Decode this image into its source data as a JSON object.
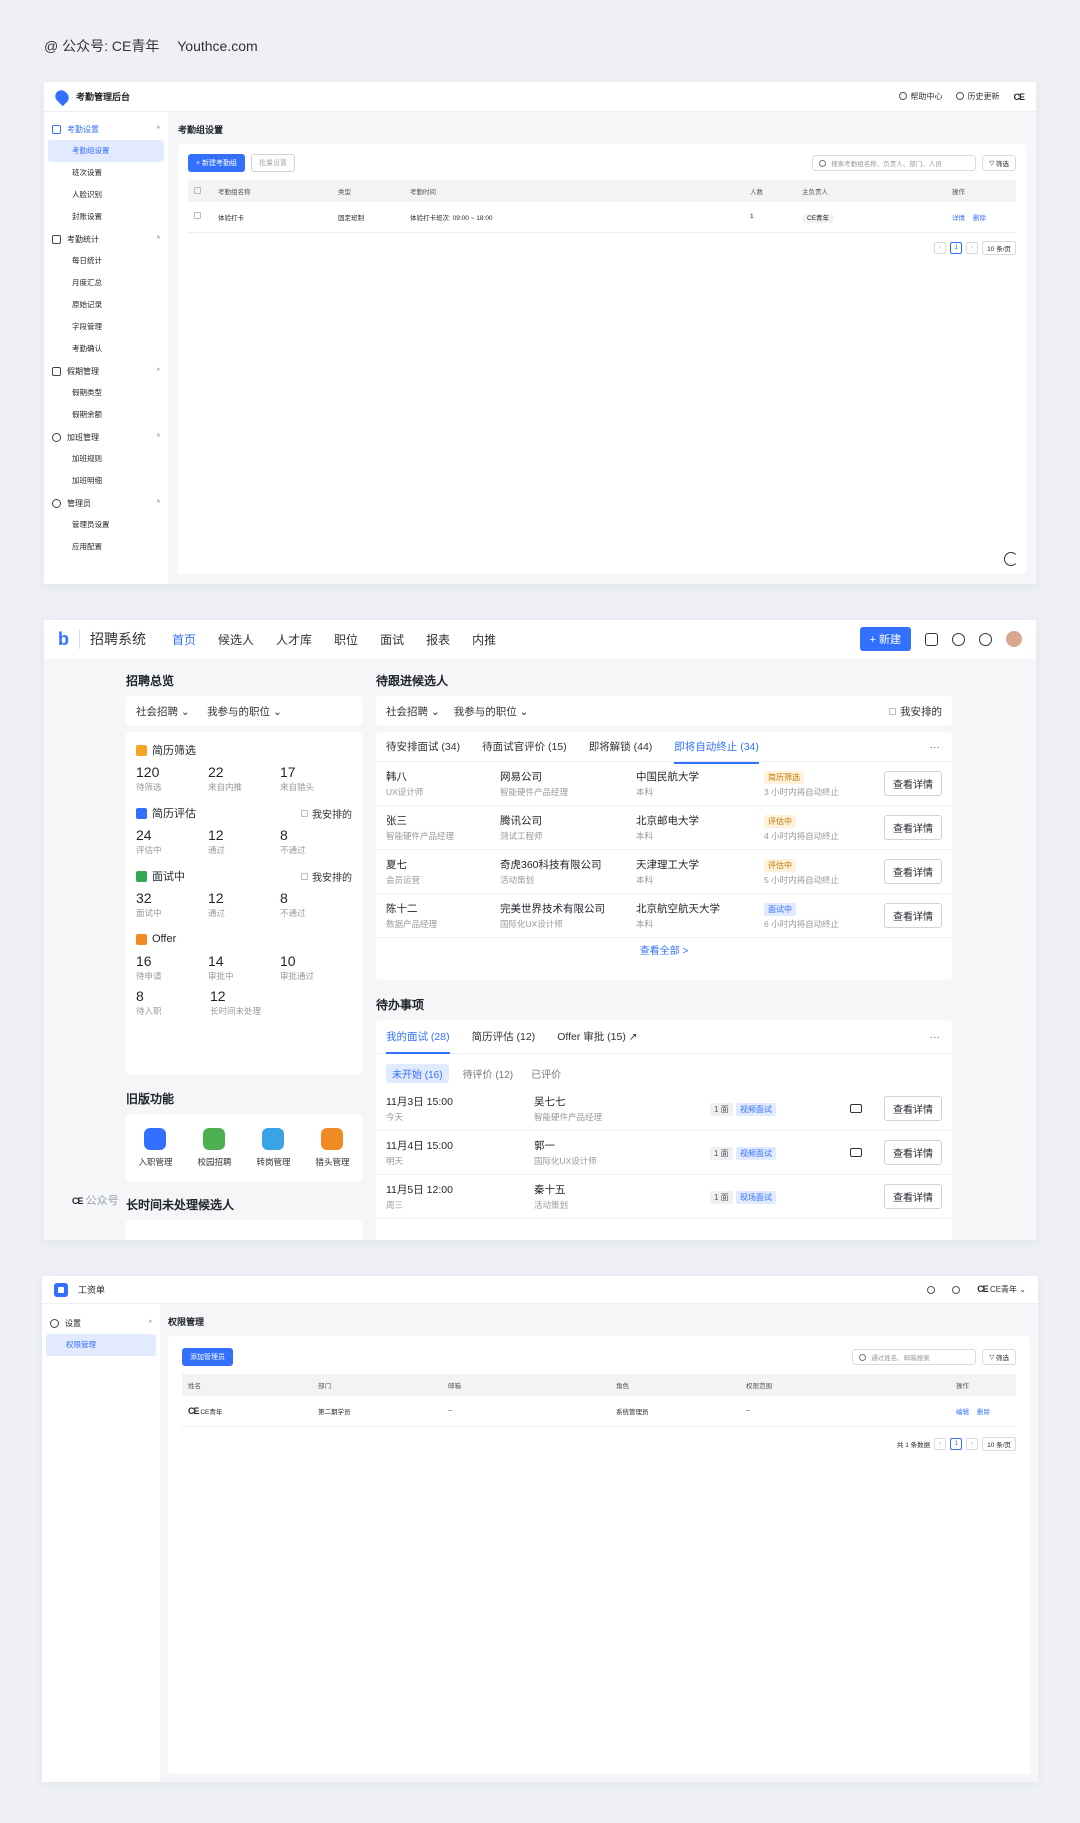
{
  "attribution": {
    "handle": "@ 公众号: CE青年",
    "site": "Youthce.com"
  },
  "panel1": {
    "app_title": "考勤管理后台",
    "help": "帮助中心",
    "history": "历史更新",
    "sidebar": [
      {
        "group": "考勤设置",
        "items": [
          "考勤组设置",
          "班次设置",
          "人脸识别",
          "封账设置"
        ]
      },
      {
        "group": "考勤统计",
        "items": [
          "每日统计",
          "月度汇总",
          "原始记录",
          "字段管理",
          "考勤确认"
        ]
      },
      {
        "group": "假期管理",
        "items": [
          "假期类型",
          "假期余额"
        ]
      },
      {
        "group": "加班管理",
        "items": [
          "加班规则",
          "加班明细"
        ]
      },
      {
        "group": "管理员",
        "items": [
          "管理员设置",
          "应用配置"
        ]
      }
    ],
    "page_title": "考勤组设置",
    "new_btn": "+ 新建考勤组",
    "batch_btn": "批量设置",
    "search_placeholder": "搜索考勤组名称、负责人、部门、人员",
    "filter": "筛选",
    "columns": [
      "考勤组名称",
      "类型",
      "考勤时间",
      "人数",
      "主负责人",
      "操作"
    ],
    "rows": [
      {
        "name": "体验打卡",
        "type": "固定班制",
        "time": "体验打卡班次: 09:00 ~ 18:00",
        "count": "1",
        "owner": "CE青年",
        "detail": "详情",
        "delete": "删除"
      }
    ],
    "page": "1",
    "page_size": "10 条/页"
  },
  "panel2": {
    "system": "招聘系统",
    "nav": [
      "首页",
      "候选人",
      "人才库",
      "职位",
      "面试",
      "报表",
      "内推"
    ],
    "new_btn": "+ 新建",
    "overview_title": "招聘总览",
    "filter1": "社会招聘",
    "filter2": "我参与的职位",
    "mine": "我安排的",
    "blocks": [
      {
        "title": "简历筛选",
        "mine": false,
        "stats": [
          {
            "num": "120",
            "label": "待筛选"
          },
          {
            "num": "22",
            "label": "来自内推"
          },
          {
            "num": "17",
            "label": "来自猎头"
          }
        ]
      },
      {
        "title": "简历评估",
        "mine": true,
        "stats": [
          {
            "num": "24",
            "label": "评估中"
          },
          {
            "num": "12",
            "label": "通过"
          },
          {
            "num": "8",
            "label": "不通过"
          }
        ]
      },
      {
        "title": "面试中",
        "mine": true,
        "stats": [
          {
            "num": "32",
            "label": "面试中"
          },
          {
            "num": "12",
            "label": "通过"
          },
          {
            "num": "8",
            "label": "不通过"
          }
        ]
      },
      {
        "title": "Offer",
        "mine": false,
        "stats": [
          {
            "num": "16",
            "label": "待申请"
          },
          {
            "num": "14",
            "label": "审批中"
          },
          {
            "num": "10",
            "label": "审批通过"
          },
          {
            "num": "8",
            "label": "待入职"
          },
          {
            "num": "12",
            "label": "长时间未处理"
          }
        ]
      }
    ],
    "old_title": "旧版功能",
    "old_items": [
      "入职管理",
      "校园招聘",
      "转岗管理",
      "猎头管理"
    ],
    "long_title": "长时间未处理候选人",
    "watermark": "公众号",
    "pending_title": "待跟进候选人",
    "pending_tabs": [
      "待安排面试 (34)",
      "待面试官评价 (15)",
      "即将解锁 (44)",
      "即将自动终止 (34)"
    ],
    "candidates": [
      {
        "name": "韩八",
        "role": "UX设计师",
        "company": "网易公司",
        "crole": "智能硬件产品经理",
        "school": "中国民航大学",
        "degree": "本科",
        "status": "简历筛选",
        "note": "3 小时内将自动终止"
      },
      {
        "name": "张三",
        "role": "智能硬件产品经理",
        "company": "腾讯公司",
        "crole": "测试工程师",
        "school": "北京邮电大学",
        "degree": "本科",
        "status": "评估中",
        "note": "4 小时内将自动终止"
      },
      {
        "name": "夏七",
        "role": "会员运营",
        "company": "奇虎360科技有限公司",
        "crole": "活动策划",
        "school": "天津理工大学",
        "degree": "本科",
        "status": "评估中",
        "note": "5 小时内将自动终止"
      },
      {
        "name": "陈十二",
        "role": "数据产品经理",
        "company": "完美世界技术有限公司",
        "crole": "国际化UX设计师",
        "school": "北京航空航天大学",
        "degree": "本科",
        "status": "面试中",
        "note": "6 小时内将自动终止"
      }
    ],
    "view_detail": "查看详情",
    "see_all": "查看全部 >",
    "todo_title": "待办事项",
    "todo_tabs": [
      "我的面试 (28)",
      "简历评估 (12)",
      "Offer 审批 (15) ↗"
    ],
    "todo_subtabs": [
      "未开始 (16)",
      "待评价 (12)",
      "已评价"
    ],
    "interviews": [
      {
        "time": "11月3日 15:00",
        "day": "今天",
        "name": "吴七七",
        "role": "智能硬件产品经理",
        "round": "1 面",
        "kind": "视频面试",
        "video": true
      },
      {
        "time": "11月4日 15:00",
        "day": "明天",
        "name": "郭一",
        "role": "国际化UX设计师",
        "round": "1 面",
        "kind": "视频面试",
        "video": true
      },
      {
        "time": "11月5日 12:00",
        "day": "周三",
        "name": "秦十五",
        "role": "活动策划",
        "round": "1 面",
        "kind": "现场面试",
        "video": false
      }
    ]
  },
  "panel3": {
    "app_title": "工资单",
    "user": "CE青年",
    "side_group": "设置",
    "side_item": "权限管理",
    "page_title": "权限管理",
    "add_btn": "添加管理员",
    "search_placeholder": "通过姓名、邮箱搜索",
    "filter": "筛选",
    "columns": [
      "姓名",
      "部门",
      "邮箱",
      "角色",
      "权限范围",
      "操作"
    ],
    "rows": [
      {
        "name": "CE青年",
        "dept": "第二期学员",
        "email": "--",
        "role": "系统管理员",
        "scope": "--",
        "edit": "编辑",
        "delete": "删除"
      }
    ],
    "total": "共 1 条数据",
    "page": "1",
    "page_size": "10 条/页"
  }
}
